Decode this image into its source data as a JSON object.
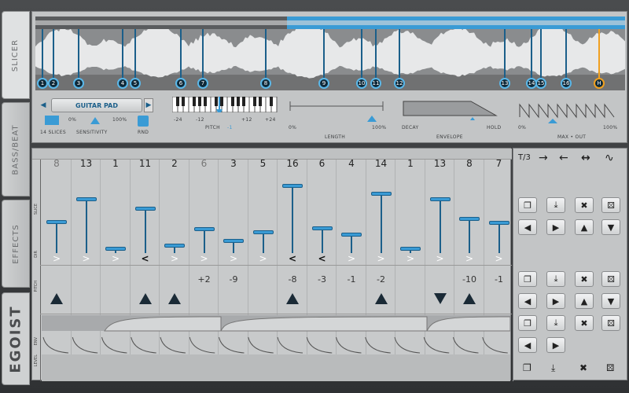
{
  "tabs": [
    {
      "label": "SLICER"
    },
    {
      "label": "BASS/BEAT"
    },
    {
      "label": "EFFECTS"
    }
  ],
  "brand": "EGOIST",
  "slicer": {
    "markers": [
      "1",
      "2",
      "3",
      "4",
      "5",
      "6",
      "7",
      "8",
      "9",
      "10",
      "11",
      "12",
      "13",
      "14",
      "15",
      "16",
      "H"
    ],
    "preset": "GUITAR PAD",
    "slices_label": "14 SLICES",
    "sensitivity_label": "SENSITIVITY",
    "sens_min": "0%",
    "sens_max": "100%",
    "rnd_label": "RND",
    "pitch_ticks": [
      "-24",
      "-12",
      "+12",
      "+24"
    ],
    "pitch_label": "PITCH",
    "pitch_value": "-1",
    "length_min": "0%",
    "length_max": "100%",
    "length_label": "LENGTH",
    "env_decay": "DECAY",
    "env_hold": "HOLD",
    "env_label": "ENVELOPE",
    "max_min": "0%",
    "max_max": "100%",
    "max_label": "MAX • OUT"
  },
  "grid": {
    "row_labels": {
      "slice": "SLICE",
      "dir": "DIR",
      "pitch": "PITCH",
      "env": "ENV",
      "level": "LEVEL"
    },
    "steps": [
      {
        "slice": "8",
        "height": 0.42,
        "dir": ">",
        "pitch": "",
        "tri": "up"
      },
      {
        "slice": "13",
        "height": 0.72,
        "dir": ">",
        "pitch": "",
        "tri": ""
      },
      {
        "slice": "1",
        "height": 0.05,
        "dir": ">",
        "pitch": "",
        "tri": ""
      },
      {
        "slice": "11",
        "height": 0.6,
        "dir": "<",
        "pitch": "",
        "tri": "up"
      },
      {
        "slice": "2",
        "height": 0.1,
        "dir": ">",
        "pitch": "",
        "tri": "up"
      },
      {
        "slice": "6",
        "height": 0.32,
        "dir": ">",
        "pitch": "+2",
        "tri": ""
      },
      {
        "slice": "3",
        "height": 0.16,
        "dir": ">",
        "pitch": "-9",
        "tri": ""
      },
      {
        "slice": "5",
        "height": 0.28,
        "dir": ">",
        "pitch": "",
        "tri": ""
      },
      {
        "slice": "16",
        "height": 0.9,
        "dir": "<",
        "pitch": "-8",
        "tri": "up"
      },
      {
        "slice": "6",
        "height": 0.33,
        "dir": "<",
        "pitch": "-3",
        "tri": ""
      },
      {
        "slice": "4",
        "height": 0.25,
        "dir": ">",
        "pitch": "-1",
        "tri": ""
      },
      {
        "slice": "14",
        "height": 0.8,
        "dir": ">",
        "pitch": "-2",
        "tri": "up"
      },
      {
        "slice": "1",
        "height": 0.05,
        "dir": ">",
        "pitch": "",
        "tri": ""
      },
      {
        "slice": "13",
        "height": 0.72,
        "dir": ">",
        "pitch": "",
        "tri": "down"
      },
      {
        "slice": "8",
        "height": 0.46,
        "dir": ">",
        "pitch": "-10",
        "tri": "up"
      },
      {
        "slice": "7",
        "height": 0.4,
        "dir": ">",
        "pitch": "-1",
        "tri": ""
      }
    ]
  },
  "right": {
    "rate": "T/3",
    "dirs": [
      "→",
      "←",
      "↔",
      "∿"
    ]
  },
  "colors": {
    "accent": "#3a9bd5",
    "marker": "#0f2a3a",
    "highlight": "#f0a020"
  }
}
